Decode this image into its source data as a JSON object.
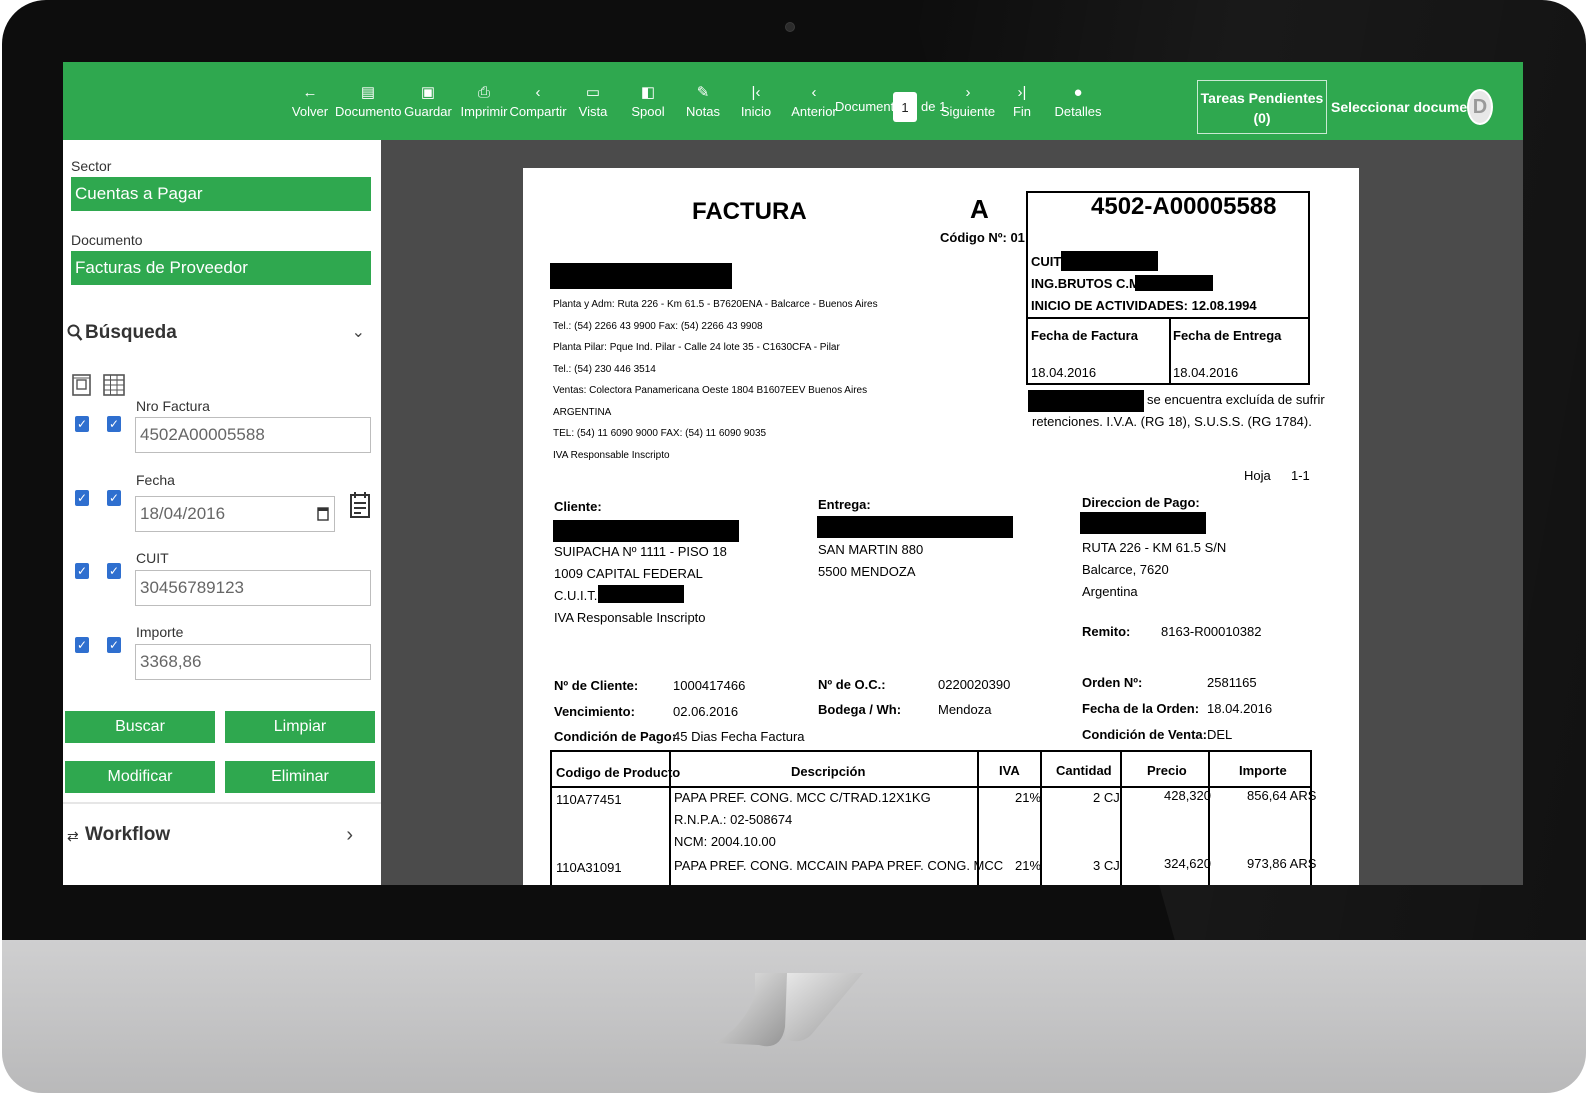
{
  "toolbar": {
    "buttons": [
      {
        "icon": "back-arrow-icon",
        "glyph": "←",
        "label": "Volver"
      },
      {
        "icon": "document-icon",
        "glyph": "▤",
        "label": "Documento"
      },
      {
        "icon": "save-icon",
        "glyph": "▣",
        "label": "Guardar"
      },
      {
        "icon": "print-icon",
        "glyph": "⎙",
        "label": "Imprimir"
      },
      {
        "icon": "share-icon",
        "glyph": "‹",
        "label": "Compartir"
      },
      {
        "icon": "monitor-icon",
        "glyph": "▭",
        "label": "Vista"
      },
      {
        "icon": "spool-icon",
        "glyph": "◧",
        "label": "Spool"
      },
      {
        "icon": "pencil-icon",
        "glyph": "✎",
        "label": "Notas"
      },
      {
        "icon": "first-page-icon",
        "glyph": "|‹",
        "label": "Inicio"
      },
      {
        "icon": "prev-page-icon",
        "glyph": "‹",
        "label": "Anterior"
      },
      {
        "icon": "next-page-icon",
        "glyph": "›",
        "label": "Siguiente"
      },
      {
        "icon": "last-page-icon",
        "glyph": "›|",
        "label": "Fin"
      },
      {
        "icon": "info-icon",
        "glyph": "●",
        "label": "Detalles"
      }
    ],
    "doc_nav_label": "Documento",
    "doc_page": "1",
    "doc_of_label": "de 1",
    "tareas_label": "Tareas Pendientes",
    "tareas_count": "(0)",
    "select_doc_label": "Seleccionar documental",
    "avatar_initial": "D",
    "color": "#2fa84f"
  },
  "sidebar": {
    "sector_label": "Sector",
    "sector_value": "Cuentas a Pagar",
    "documento_label": "Documento",
    "documento_value": "Facturas de Proveedor",
    "busqueda_title": "Búsqueda",
    "fields": [
      {
        "label": "Nro Factura",
        "value": "4502A00005588"
      },
      {
        "label": "Fecha",
        "value": "18/04/2016"
      },
      {
        "label": "CUIT",
        "value": "30456789123"
      },
      {
        "label": "Importe",
        "value": "3368,86"
      }
    ],
    "buttons": {
      "buscar": "Buscar",
      "limpiar": "Limpiar",
      "modificar": "Modificar",
      "eliminar": "Eliminar"
    },
    "workflow_title": "Workflow"
  },
  "invoice": {
    "title": "FACTURA",
    "letter": "A",
    "codigo": "Código Nº: 01",
    "number": "4502-A00005588",
    "cuit_label": "CUIT:",
    "ing_brutos_label": "ING.BRUTOS C.M.:",
    "inicio_actividades": "INICIO DE ACTIVIDADES: 12.08.1994",
    "fecha_factura_label": "Fecha de Factura",
    "fecha_factura": "18.04.2016",
    "fecha_entrega_label": "Fecha de Entrega",
    "fecha_entrega": "18.04.2016",
    "exclusion_line1": "se encuentra excluída de sufrir",
    "exclusion_line2": "retenciones. I.V.A. (RG 18), S.U.S.S. (RG 1784).",
    "company_lines": [
      "Planta y Adm: Ruta 226 - Km 61.5 - B7620ENA - Balcarce - Buenos Aires",
      "Tel.: (54) 2266 43 9900   Fax: (54) 2266 43 9908",
      "Planta Pilar: Pque Ind. Pilar - Calle 24 lote 35 - C1630CFA - Pilar",
      "Tel.: (54) 230 446 3514",
      "Ventas: Colectora Panamericana Oeste 1804 B1607EEV Buenos Aires",
      "ARGENTINA",
      "TEL: (54) 11 6090 9000 FAX: (54) 11 6090 9035",
      "IVA Responsable Inscripto"
    ],
    "hoja_label": "Hoja",
    "hoja_value": "1-1",
    "cliente_label": "Cliente:",
    "cliente_lines": [
      "SUIPACHA Nº 1111 - PISO 18",
      " 1009 CAPITAL FEDERAL",
      "C.U.I.T.:",
      "IVA Responsable Inscripto"
    ],
    "entrega_label": "Entrega:",
    "entrega_lines": [
      "SAN MARTIN 880",
      " 5500 MENDOZA"
    ],
    "pago_label": "Direccion de Pago:",
    "pago_lines": [
      "RUTA 226 - KM 61.5 S/N",
      "Balcarce, 7620",
      "Argentina"
    ],
    "remito_label": "Remito:",
    "remito_value": "8163-R00010382",
    "meta": [
      {
        "label": "Nº de Cliente:",
        "value": "1000417466"
      },
      {
        "label": "Vencimiento:",
        "value": "02.06.2016"
      },
      {
        "label": "Condición de Pago:",
        "value": "45 Dias Fecha Factura"
      },
      {
        "label": "Nº de O.C.:",
        "value": "0220020390"
      },
      {
        "label": "Bodega / Wh:",
        "value": "Mendoza"
      },
      {
        "label": "Orden Nº:",
        "value": "2581165"
      },
      {
        "label": "Fecha de la Orden:",
        "value": "18.04.2016"
      },
      {
        "label": "Condición de Venta:",
        "value": "DEL"
      }
    ],
    "table_headers": [
      "Codigo de Producto",
      "Descripción",
      "IVA",
      "Cantidad",
      "Precio",
      "Importe"
    ],
    "rows": [
      {
        "code": "110A77451",
        "desc": [
          "PAPA PREF. CONG. MCC C/TRAD.12X1KG",
          "R.N.P.A.: 02-508674",
          "NCM: 2004.10.00"
        ],
        "iva": "21%",
        "qty": "2 CJ",
        "price": "428,320",
        "amount": "856,64 ARS"
      },
      {
        "code": "110A31091",
        "desc": [
          "PAPA PREF. CONG. MCCAIN PAPA PREF. CONG. MCC"
        ],
        "iva": "21%",
        "qty": "3 CJ",
        "price": "324,620",
        "amount": "973,86 ARS"
      }
    ]
  }
}
